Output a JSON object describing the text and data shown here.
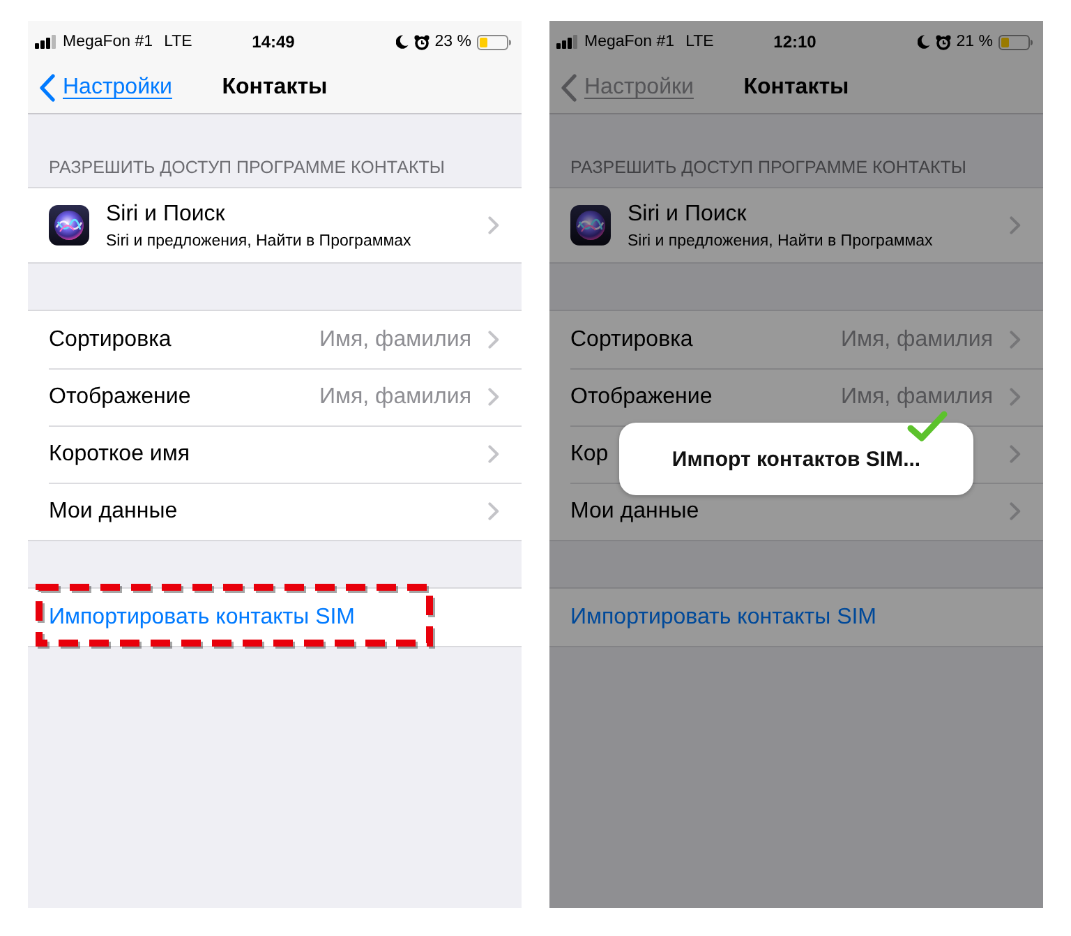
{
  "screens": [
    {
      "dimmed": false,
      "status_bar": {
        "carrier": "MegaFon #1",
        "network": "LTE",
        "time": "14:49",
        "battery": "23 %"
      },
      "nav_bar": {
        "back": "Настройки",
        "title": "Контакты"
      },
      "sections": [
        {
          "header": "РАЗРЕШИТЬ ДОСТУП ПРОГРАММЕ КОНТАКТЫ",
          "rows": [
            {
              "kind": "app",
              "title": "Siri и Поиск",
              "subtitle": "Siri и предложения, Найти в Программах"
            }
          ]
        },
        {
          "rows": [
            {
              "kind": "disclosure",
              "label": "Сортировка",
              "value": "Имя, фамилия"
            },
            {
              "kind": "disclosure",
              "label": "Отображение",
              "value": "Имя, фамилия"
            },
            {
              "kind": "disclosure",
              "label": "Короткое имя"
            },
            {
              "kind": "disclosure",
              "label": "Мои данные"
            }
          ]
        },
        {
          "rows": [
            {
              "kind": "action",
              "label": "Импортировать контакты SIM",
              "highlighted": true
            }
          ]
        }
      ]
    },
    {
      "dimmed": true,
      "status_bar": {
        "carrier": "MegaFon #1",
        "network": "LTE",
        "time": "12:10",
        "battery": "21 %"
      },
      "nav_bar": {
        "back": "Настройки",
        "title": "Контакты"
      },
      "sections": [
        {
          "header": "РАЗРЕШИТЬ ДОСТУП ПРОГРАММЕ КОНТАКТЫ",
          "rows": [
            {
              "kind": "app",
              "title": "Siri и Поиск",
              "subtitle": "Siri и предложения, Найти в Программах"
            }
          ]
        },
        {
          "rows": [
            {
              "kind": "disclosure",
              "label": "Сортировка",
              "value": "Имя, фамилия"
            },
            {
              "kind": "disclosure",
              "label": "Отображение",
              "value": "Имя, фамилия"
            },
            {
              "kind": "disclosure",
              "label": "Кор"
            },
            {
              "kind": "disclosure",
              "label": "Мои данные"
            }
          ]
        },
        {
          "rows": [
            {
              "kind": "action",
              "label": "Импортировать контакты SIM",
              "highlighted": false
            }
          ]
        }
      ],
      "popup": {
        "text": "Импорт контактов SIM...",
        "check_mark": true
      }
    }
  ]
}
